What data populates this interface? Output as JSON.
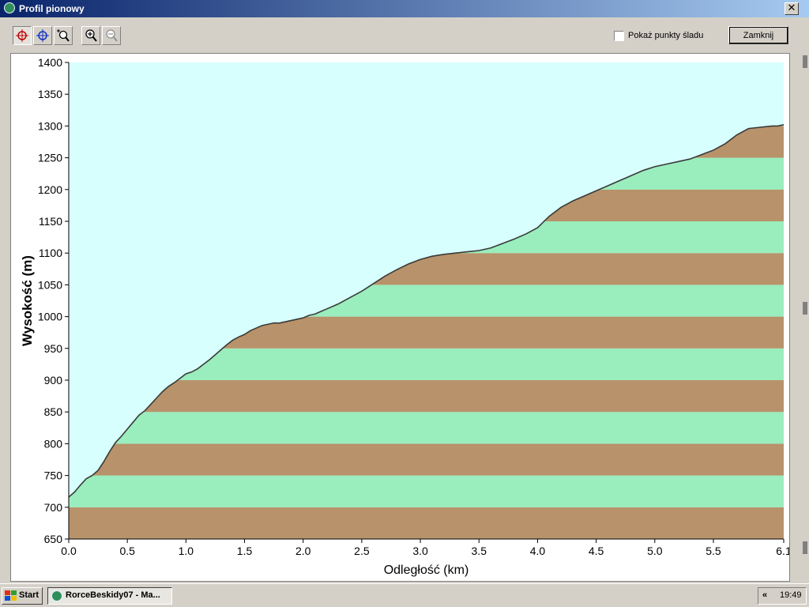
{
  "window": {
    "title": "Profil pionowy",
    "close_symbol": "✕"
  },
  "toolbar": {
    "buttons": [
      {
        "icon": "crosshair-red-icon",
        "pressed": true
      },
      {
        "icon": "crosshair-blue-icon",
        "pressed": false
      },
      {
        "icon": "zoom-window-icon",
        "pressed": false
      },
      {
        "icon": "zoom-in-icon",
        "pressed": false
      },
      {
        "icon": "zoom-out-icon",
        "pressed": false
      }
    ],
    "show_points_label": "Pokaż punkty śladu",
    "show_points_checked": false,
    "close_button_label": "Zamknij"
  },
  "chart_data": {
    "type": "area",
    "xlabel": "Odległość  (km)",
    "ylabel": "Wysokość (m)",
    "xlim": [
      0,
      6.1
    ],
    "ylim": [
      650,
      1400
    ],
    "x_ticks": [
      "0.0",
      "0.5",
      "1.0",
      "1.5",
      "2.0",
      "2.5",
      "3.0",
      "3.5",
      "4.0",
      "4.5",
      "5.0",
      "5.5",
      "6.1"
    ],
    "x_tick_values": [
      0,
      0.5,
      1.0,
      1.5,
      2.0,
      2.5,
      3.0,
      3.5,
      4.0,
      4.5,
      5.0,
      5.5,
      6.1
    ],
    "y_ticks": [
      "650",
      "700",
      "750",
      "800",
      "850",
      "900",
      "950",
      "1000",
      "1050",
      "1100",
      "1150",
      "1200",
      "1250",
      "1300",
      "1350",
      "1400"
    ],
    "y_tick_values": [
      650,
      700,
      750,
      800,
      850,
      900,
      950,
      1000,
      1050,
      1100,
      1150,
      1200,
      1250,
      1300,
      1350,
      1400
    ],
    "band_step": 50,
    "colors": {
      "sky": "#d7fffe",
      "band_brown": "#b8926a",
      "band_green": "#9aedbd",
      "line": "#3a3a3a"
    },
    "x": [
      0,
      0.05,
      0.1,
      0.15,
      0.2,
      0.25,
      0.3,
      0.35,
      0.4,
      0.45,
      0.5,
      0.55,
      0.6,
      0.65,
      0.7,
      0.75,
      0.8,
      0.85,
      0.9,
      0.95,
      1.0,
      1.05,
      1.1,
      1.15,
      1.2,
      1.25,
      1.3,
      1.35,
      1.4,
      1.45,
      1.5,
      1.55,
      1.6,
      1.65,
      1.7,
      1.75,
      1.8,
      1.85,
      1.9,
      1.95,
      2.0,
      2.05,
      2.1,
      2.15,
      2.2,
      2.3,
      2.4,
      2.5,
      2.6,
      2.7,
      2.8,
      2.9,
      3.0,
      3.1,
      3.2,
      3.3,
      3.4,
      3.5,
      3.6,
      3.7,
      3.8,
      3.9,
      4.0,
      4.1,
      4.2,
      4.3,
      4.4,
      4.5,
      4.6,
      4.7,
      4.8,
      4.9,
      5.0,
      5.1,
      5.2,
      5.3,
      5.4,
      5.5,
      5.6,
      5.7,
      5.8,
      5.9,
      6.0,
      6.05,
      6.1
    ],
    "y": [
      716,
      724,
      735,
      745,
      750,
      758,
      772,
      788,
      802,
      812,
      823,
      834,
      845,
      852,
      862,
      872,
      882,
      890,
      896,
      903,
      910,
      913,
      918,
      925,
      932,
      940,
      948,
      956,
      963,
      968,
      972,
      978,
      982,
      986,
      988,
      990,
      990,
      992,
      994,
      996,
      998,
      1002,
      1004,
      1008,
      1012,
      1020,
      1030,
      1040,
      1052,
      1064,
      1074,
      1083,
      1090,
      1095,
      1098,
      1100,
      1102,
      1104,
      1108,
      1115,
      1122,
      1130,
      1140,
      1158,
      1172,
      1182,
      1190,
      1198,
      1206,
      1214,
      1222,
      1230,
      1236,
      1240,
      1244,
      1248,
      1255,
      1262,
      1272,
      1286,
      1296,
      1298,
      1300,
      1300,
      1302
    ]
  },
  "taskbar": {
    "start_label": "Start",
    "task_label": "RorceBeskidy07 - Ma...",
    "tray_chevron": "«",
    "clock": "19:49"
  }
}
